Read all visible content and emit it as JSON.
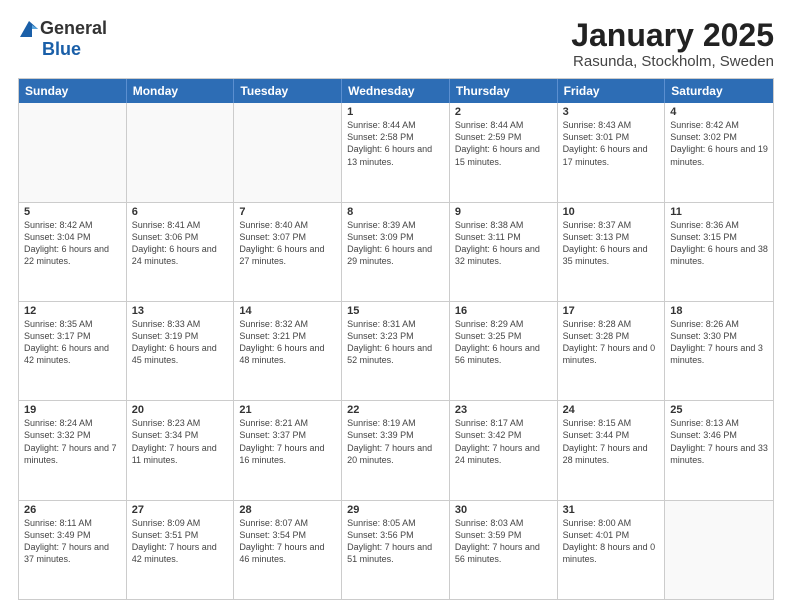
{
  "header": {
    "logo_general": "General",
    "logo_blue": "Blue",
    "month_year": "January 2025",
    "location": "Rasunda, Stockholm, Sweden"
  },
  "day_headers": [
    "Sunday",
    "Monday",
    "Tuesday",
    "Wednesday",
    "Thursday",
    "Friday",
    "Saturday"
  ],
  "weeks": [
    [
      {
        "day": "",
        "empty": true
      },
      {
        "day": "",
        "empty": true
      },
      {
        "day": "",
        "empty": true
      },
      {
        "day": "1",
        "sunrise": "8:44 AM",
        "sunset": "2:58 PM",
        "daylight": "6 hours and 13 minutes."
      },
      {
        "day": "2",
        "sunrise": "8:44 AM",
        "sunset": "2:59 PM",
        "daylight": "6 hours and 15 minutes."
      },
      {
        "day": "3",
        "sunrise": "8:43 AM",
        "sunset": "3:01 PM",
        "daylight": "6 hours and 17 minutes."
      },
      {
        "day": "4",
        "sunrise": "8:42 AM",
        "sunset": "3:02 PM",
        "daylight": "6 hours and 19 minutes."
      }
    ],
    [
      {
        "day": "5",
        "sunrise": "8:42 AM",
        "sunset": "3:04 PM",
        "daylight": "6 hours and 22 minutes."
      },
      {
        "day": "6",
        "sunrise": "8:41 AM",
        "sunset": "3:06 PM",
        "daylight": "6 hours and 24 minutes."
      },
      {
        "day": "7",
        "sunrise": "8:40 AM",
        "sunset": "3:07 PM",
        "daylight": "6 hours and 27 minutes."
      },
      {
        "day": "8",
        "sunrise": "8:39 AM",
        "sunset": "3:09 PM",
        "daylight": "6 hours and 29 minutes."
      },
      {
        "day": "9",
        "sunrise": "8:38 AM",
        "sunset": "3:11 PM",
        "daylight": "6 hours and 32 minutes."
      },
      {
        "day": "10",
        "sunrise": "8:37 AM",
        "sunset": "3:13 PM",
        "daylight": "6 hours and 35 minutes."
      },
      {
        "day": "11",
        "sunrise": "8:36 AM",
        "sunset": "3:15 PM",
        "daylight": "6 hours and 38 minutes."
      }
    ],
    [
      {
        "day": "12",
        "sunrise": "8:35 AM",
        "sunset": "3:17 PM",
        "daylight": "6 hours and 42 minutes."
      },
      {
        "day": "13",
        "sunrise": "8:33 AM",
        "sunset": "3:19 PM",
        "daylight": "6 hours and 45 minutes."
      },
      {
        "day": "14",
        "sunrise": "8:32 AM",
        "sunset": "3:21 PM",
        "daylight": "6 hours and 48 minutes."
      },
      {
        "day": "15",
        "sunrise": "8:31 AM",
        "sunset": "3:23 PM",
        "daylight": "6 hours and 52 minutes."
      },
      {
        "day": "16",
        "sunrise": "8:29 AM",
        "sunset": "3:25 PM",
        "daylight": "6 hours and 56 minutes."
      },
      {
        "day": "17",
        "sunrise": "8:28 AM",
        "sunset": "3:28 PM",
        "daylight": "7 hours and 0 minutes."
      },
      {
        "day": "18",
        "sunrise": "8:26 AM",
        "sunset": "3:30 PM",
        "daylight": "7 hours and 3 minutes."
      }
    ],
    [
      {
        "day": "19",
        "sunrise": "8:24 AM",
        "sunset": "3:32 PM",
        "daylight": "7 hours and 7 minutes."
      },
      {
        "day": "20",
        "sunrise": "8:23 AM",
        "sunset": "3:34 PM",
        "daylight": "7 hours and 11 minutes."
      },
      {
        "day": "21",
        "sunrise": "8:21 AM",
        "sunset": "3:37 PM",
        "daylight": "7 hours and 16 minutes."
      },
      {
        "day": "22",
        "sunrise": "8:19 AM",
        "sunset": "3:39 PM",
        "daylight": "7 hours and 20 minutes."
      },
      {
        "day": "23",
        "sunrise": "8:17 AM",
        "sunset": "3:42 PM",
        "daylight": "7 hours and 24 minutes."
      },
      {
        "day": "24",
        "sunrise": "8:15 AM",
        "sunset": "3:44 PM",
        "daylight": "7 hours and 28 minutes."
      },
      {
        "day": "25",
        "sunrise": "8:13 AM",
        "sunset": "3:46 PM",
        "daylight": "7 hours and 33 minutes."
      }
    ],
    [
      {
        "day": "26",
        "sunrise": "8:11 AM",
        "sunset": "3:49 PM",
        "daylight": "7 hours and 37 minutes."
      },
      {
        "day": "27",
        "sunrise": "8:09 AM",
        "sunset": "3:51 PM",
        "daylight": "7 hours and 42 minutes."
      },
      {
        "day": "28",
        "sunrise": "8:07 AM",
        "sunset": "3:54 PM",
        "daylight": "7 hours and 46 minutes."
      },
      {
        "day": "29",
        "sunrise": "8:05 AM",
        "sunset": "3:56 PM",
        "daylight": "7 hours and 51 minutes."
      },
      {
        "day": "30",
        "sunrise": "8:03 AM",
        "sunset": "3:59 PM",
        "daylight": "7 hours and 56 minutes."
      },
      {
        "day": "31",
        "sunrise": "8:00 AM",
        "sunset": "4:01 PM",
        "daylight": "8 hours and 0 minutes."
      },
      {
        "day": "",
        "empty": true
      }
    ]
  ],
  "labels": {
    "sunrise_prefix": "Sunrise: ",
    "sunset_prefix": "Sunset: ",
    "daylight_prefix": "Daylight: "
  }
}
